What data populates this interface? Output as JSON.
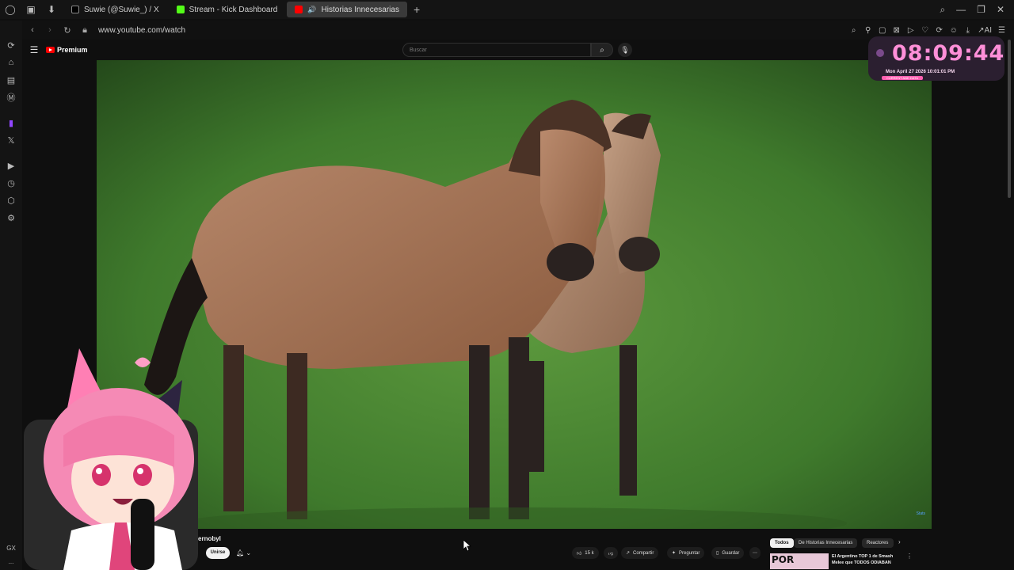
{
  "tabs": [
    {
      "label": "Suwie (@Suwie_) / X",
      "favicon_color": "#111111"
    },
    {
      "label": "Stream - Kick Dashboard",
      "favicon_color": "#53fc18"
    },
    {
      "label": "Historias Innecesarias",
      "favicon_color": "#ff0000",
      "active": true
    }
  ],
  "address_bar": {
    "url": "www.youtube.com/watch"
  },
  "yt_header": {
    "logo_text": "Premium",
    "search_placeholder": "Buscar"
  },
  "clock": {
    "time": "08:09:44",
    "date": "Mon April 27 2026 10:01:01 PM",
    "tag": "CURRENT AND DATA"
  },
  "video": {
    "corner_text": "Stats"
  },
  "meta": {
    "channel_partial": "ernobyl",
    "join_label": "Unirse",
    "like_count": "15 k",
    "share_label": "Compartir",
    "ask_label": "Preguntar",
    "save_label": "Guardar",
    "chips": [
      "Todos",
      "De Historias Innecesarias",
      "Reactores"
    ],
    "rec_thumb_text": "POR",
    "rec_title": "El Argentino TOP 1 de Smash Melee que TODOS ODIABAN"
  },
  "sidebar_bottom": {
    "gx": "GX",
    "more": "..."
  },
  "colors": {
    "accent_pink": "#ff8fd8",
    "youtube_red": "#ff0000",
    "kick_green": "#53fc18",
    "twitch_purple": "#9146ff"
  }
}
